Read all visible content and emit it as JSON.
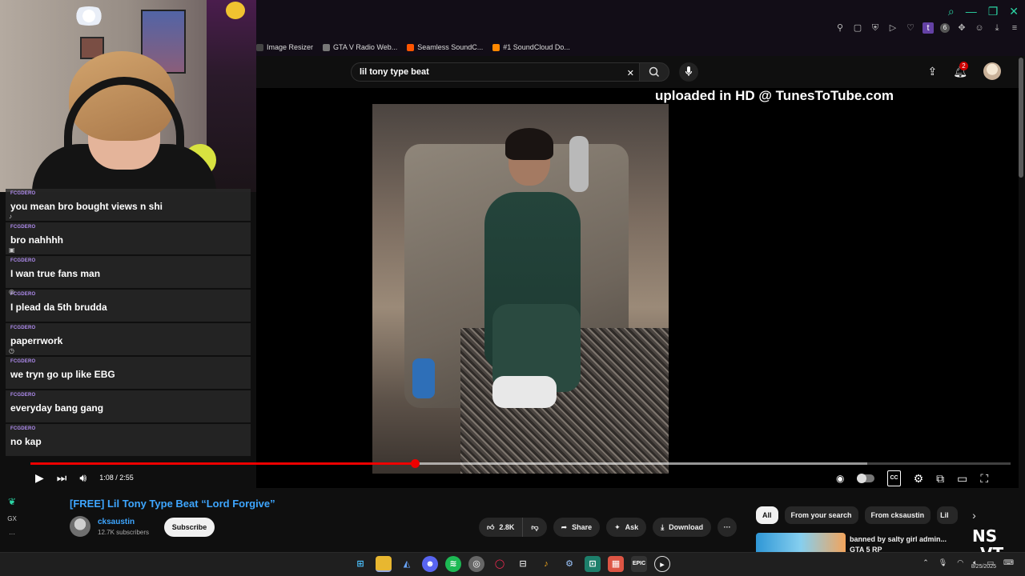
{
  "bookmarks": [
    {
      "label": "Image Resizer",
      "color": "#444444"
    },
    {
      "label": "GTA V Radio Web...",
      "color": "#777777"
    },
    {
      "label": "Seamless SoundC...",
      "color": "#ff5500"
    },
    {
      "label": "#1 SoundCloud Do...",
      "color": "#ff8800"
    }
  ],
  "header": {
    "search_value": "lil tony type beat",
    "notification_count": "2"
  },
  "player": {
    "overlay_text": "uploaded in HD @ TunesToTube.com",
    "time": "1:08 / 2:55",
    "progress_played": 0.392,
    "progress_buffered": 0.854
  },
  "video": {
    "title": "[FREE] Lil Tony Type Beat “Lord Forgive”",
    "channel": "cksaustin",
    "subscribers": "12.7K subscribers",
    "subscribe_label": "Subscribe",
    "likes": "2.8K",
    "share_label": "Share",
    "ask_label": "Ask",
    "download_label": "Download"
  },
  "chips": [
    "All",
    "From your search",
    "From cksaustin",
    "Lil"
  ],
  "recommendation": {
    "title": "banned by salty girl admin...",
    "subtitle": "GTA 5 RP"
  },
  "sidebar_strip": [
    "GX",
    "···"
  ],
  "watermark": {
    "top": "NS",
    "bottom": "VT"
  },
  "chat": [
    {
      "user": "FCGDERO",
      "text": "you mean bro bought views n shi",
      "icon": "♪"
    },
    {
      "user": "FCGDERO",
      "text": "bro nahhhh",
      "icon": "▣"
    },
    {
      "user": "FCGDERO",
      "text": "I wan true fans man",
      "icon": ""
    },
    {
      "user": "FCGDERO",
      "text": "I plead da 5th brudda",
      "icon": "◎"
    },
    {
      "user": "FCGDERO",
      "text": "paperrwork",
      "icon": "◷"
    },
    {
      "user": "FCGDERO",
      "text": "we tryn go up like EBG",
      "icon": ""
    },
    {
      "user": "FCGDERO",
      "text": "everyday bang gang",
      "icon": ""
    },
    {
      "user": "FCGDERO",
      "text": "no kap",
      "icon": ""
    }
  ],
  "taskbar": {
    "date": "8/25/2025"
  },
  "colors": {
    "accent_red": "#ee0000",
    "chat_user": "#b08cf0",
    "link_blue": "#3ea6ff",
    "opera_gx": "#2bd4a4"
  }
}
